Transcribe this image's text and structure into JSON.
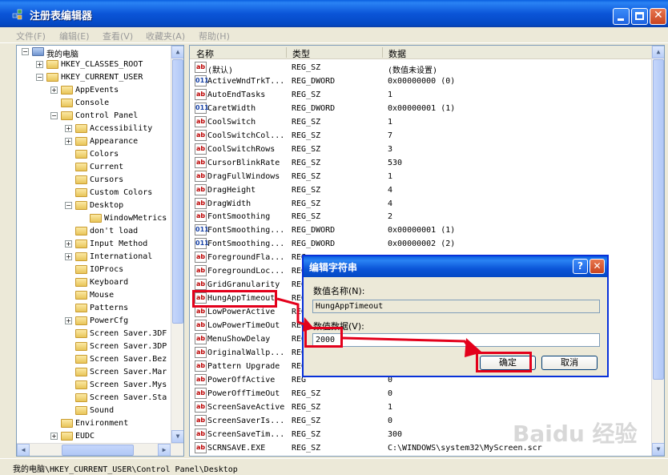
{
  "window": {
    "title": "注册表编辑器"
  },
  "menu": [
    "文件(F)",
    "编辑(E)",
    "查看(V)",
    "收藏夹(A)",
    "帮助(H)"
  ],
  "tree": [
    {
      "label": "我的电脑",
      "exp": "−",
      "indent": 0
    },
    {
      "label": "HKEY_CLASSES_ROOT",
      "exp": "+",
      "indent": 1
    },
    {
      "label": "HKEY_CURRENT_USER",
      "exp": "−",
      "indent": 1
    },
    {
      "label": "AppEvents",
      "exp": "+",
      "indent": 2
    },
    {
      "label": "Console",
      "exp": "",
      "indent": 2
    },
    {
      "label": "Control Panel",
      "exp": "−",
      "indent": 2
    },
    {
      "label": "Accessibility",
      "exp": "+",
      "indent": 3
    },
    {
      "label": "Appearance",
      "exp": "+",
      "indent": 3
    },
    {
      "label": "Colors",
      "exp": "",
      "indent": 3
    },
    {
      "label": "Current",
      "exp": "",
      "indent": 3
    },
    {
      "label": "Cursors",
      "exp": "",
      "indent": 3
    },
    {
      "label": "Custom Colors",
      "exp": "",
      "indent": 3
    },
    {
      "label": "Desktop",
      "exp": "−",
      "indent": 3
    },
    {
      "label": "WindowMetrics",
      "exp": "",
      "indent": 4
    },
    {
      "label": "don't load",
      "exp": "",
      "indent": 3
    },
    {
      "label": "Input Method",
      "exp": "+",
      "indent": 3
    },
    {
      "label": "International",
      "exp": "+",
      "indent": 3
    },
    {
      "label": "IOProcs",
      "exp": "",
      "indent": 3
    },
    {
      "label": "Keyboard",
      "exp": "",
      "indent": 3
    },
    {
      "label": "Mouse",
      "exp": "",
      "indent": 3
    },
    {
      "label": "Patterns",
      "exp": "",
      "indent": 3
    },
    {
      "label": "PowerCfg",
      "exp": "+",
      "indent": 3
    },
    {
      "label": "Screen Saver.3DF",
      "exp": "",
      "indent": 3
    },
    {
      "label": "Screen Saver.3DP",
      "exp": "",
      "indent": 3
    },
    {
      "label": "Screen Saver.Bez",
      "exp": "",
      "indent": 3
    },
    {
      "label": "Screen Saver.Mar",
      "exp": "",
      "indent": 3
    },
    {
      "label": "Screen Saver.Mys",
      "exp": "",
      "indent": 3
    },
    {
      "label": "Screen Saver.Sta",
      "exp": "",
      "indent": 3
    },
    {
      "label": "Sound",
      "exp": "",
      "indent": 3
    },
    {
      "label": "Environment",
      "exp": "",
      "indent": 2
    },
    {
      "label": "EUDC",
      "exp": "+",
      "indent": 2
    }
  ],
  "columns": {
    "name": "名称",
    "type": "类型",
    "data": "数据"
  },
  "rows": [
    {
      "name": "(默认)",
      "type": "REG_SZ",
      "data": "(数值未设置)"
    },
    {
      "name": "ActiveWndTrkT...",
      "type": "REG_DWORD",
      "data": "0x00000000 (0)"
    },
    {
      "name": "AutoEndTasks",
      "type": "REG_SZ",
      "data": "1"
    },
    {
      "name": "CaretWidth",
      "type": "REG_DWORD",
      "data": "0x00000001 (1)"
    },
    {
      "name": "CoolSwitch",
      "type": "REG_SZ",
      "data": "1"
    },
    {
      "name": "CoolSwitchCol...",
      "type": "REG_SZ",
      "data": "7"
    },
    {
      "name": "CoolSwitchRows",
      "type": "REG_SZ",
      "data": "3"
    },
    {
      "name": "CursorBlinkRate",
      "type": "REG_SZ",
      "data": "530"
    },
    {
      "name": "DragFullWindows",
      "type": "REG_SZ",
      "data": "1"
    },
    {
      "name": "DragHeight",
      "type": "REG_SZ",
      "data": "4"
    },
    {
      "name": "DragWidth",
      "type": "REG_SZ",
      "data": "4"
    },
    {
      "name": "FontSmoothing",
      "type": "REG_SZ",
      "data": "2"
    },
    {
      "name": "FontSmoothing...",
      "type": "REG_DWORD",
      "data": "0x00000001 (1)"
    },
    {
      "name": "FontSmoothing...",
      "type": "REG_DWORD",
      "data": "0x00000002 (2)"
    },
    {
      "name": "ForegroundFla...",
      "type": "REG",
      "data": ""
    },
    {
      "name": "ForegroundLoc...",
      "type": "REG",
      "data": ""
    },
    {
      "name": "GridGranularity",
      "type": "REG",
      "data": ""
    },
    {
      "name": "HungAppTimeout",
      "type": "REG",
      "data": ""
    },
    {
      "name": "LowPowerActive",
      "type": "REG",
      "data": ""
    },
    {
      "name": "LowPowerTimeOut",
      "type": "REG",
      "data": ""
    },
    {
      "name": "MenuShowDelay",
      "type": "REG",
      "data": ""
    },
    {
      "name": "OriginalWallp...",
      "type": "REG",
      "data": ""
    },
    {
      "name": "Pattern Upgrade",
      "type": "REG",
      "data": ""
    },
    {
      "name": "PowerOffActive",
      "type": "REG",
      "data": "0"
    },
    {
      "name": "PowerOffTimeOut",
      "type": "REG_SZ",
      "data": "0"
    },
    {
      "name": "ScreenSaveActive",
      "type": "REG_SZ",
      "data": "1"
    },
    {
      "name": "ScreenSaverIs...",
      "type": "REG_SZ",
      "data": "0"
    },
    {
      "name": "ScreenSaveTim...",
      "type": "REG_SZ",
      "data": "300"
    },
    {
      "name": "SCRNSAVE.EXE",
      "type": "REG_SZ",
      "data": "C:\\WINDOWS\\system32\\MyScreen.scr"
    }
  ],
  "status": "我的电脑\\HKEY_CURRENT_USER\\Control Panel\\Desktop",
  "dialog": {
    "title": "编辑字符串",
    "name_label": "数值名称(N):",
    "name_value": "HungAppTimeout",
    "data_label": "数值数据(V):",
    "data_value": "2000",
    "ok": "确定",
    "cancel": "取消",
    "help": "?",
    "close": "✕"
  },
  "highlight_color": "#e3001b",
  "watermark": "Baidu 经验"
}
